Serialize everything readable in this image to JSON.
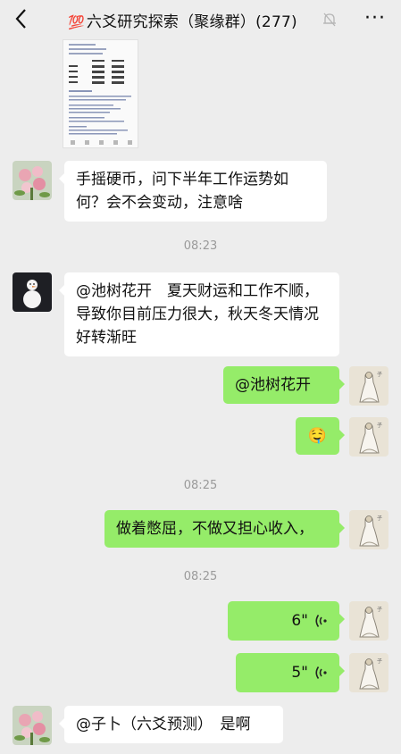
{
  "header": {
    "emoji": "💯",
    "title": "六爻研究探索（聚缘群）(277)"
  },
  "messages": [
    {
      "sender": "other-flower",
      "text": "手摇硬币，问下半年工作运势如何？会不会变动，注意啥"
    },
    {
      "time": "08:23"
    },
    {
      "sender": "other-snowman",
      "text": "@池树花开　夏天财运和工作不顺，导致你目前压力很大，秋天冬天情况好转渐旺"
    },
    {
      "sender": "me",
      "text": "@池树花开"
    },
    {
      "sender": "me",
      "text": "🤤"
    },
    {
      "time": "08:25"
    },
    {
      "sender": "me",
      "text": "做着憋屈，不做又担心收入，"
    },
    {
      "time": "08:25"
    },
    {
      "sender": "me",
      "voice": "6\""
    },
    {
      "sender": "me",
      "voice": "5\""
    },
    {
      "sender": "other-flower",
      "text": "@子卜（六爻预测）　是啊"
    }
  ],
  "icons": {
    "back": "chevron-left-icon",
    "mute": "bell-muted-icon",
    "more": "more-dots-icon",
    "voice": "voice-wave-icon"
  },
  "colors": {
    "background": "#ededed",
    "me_bubble": "#95ec69",
    "other_bubble": "#ffffff"
  }
}
